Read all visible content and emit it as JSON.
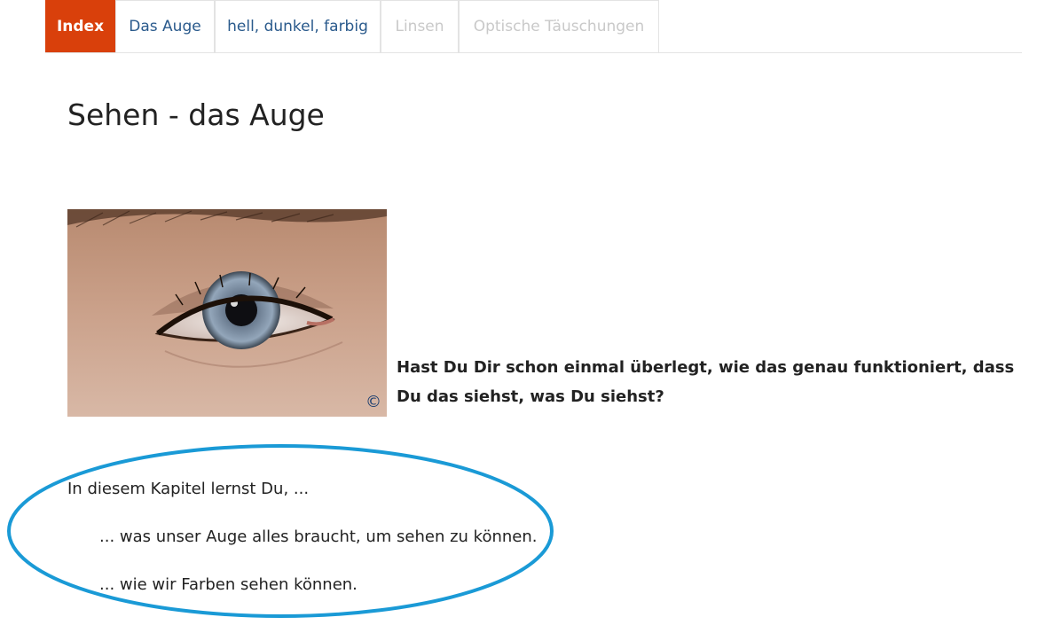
{
  "nav": {
    "tabs": [
      {
        "label": "Index",
        "state": "active"
      },
      {
        "label": "Das Auge",
        "state": "normal"
      },
      {
        "label": "hell, dunkel, farbig",
        "state": "normal"
      },
      {
        "label": "Linsen",
        "state": "disabled"
      },
      {
        "label": "Optische Täuschungen",
        "state": "disabled"
      }
    ]
  },
  "page": {
    "title": "Sehen - das Auge",
    "image": {
      "alt": "eye-photo",
      "copyright": "©"
    },
    "question": "Hast Du Dir schon einmal überlegt, wie das genau funktioniert, dass Du das siehst, was Du siehst?",
    "intro": "In diesem Kapitel lernst Du, ...",
    "bullets": [
      "... was unser Auge alles braucht, um sehen zu können.",
      "... wie wir Farben sehen können."
    ]
  },
  "colors": {
    "active_tab": "#d9400b",
    "link": "#2a5a8c",
    "disabled": "#c9c9c9",
    "annotation": "#1a9ad6"
  }
}
